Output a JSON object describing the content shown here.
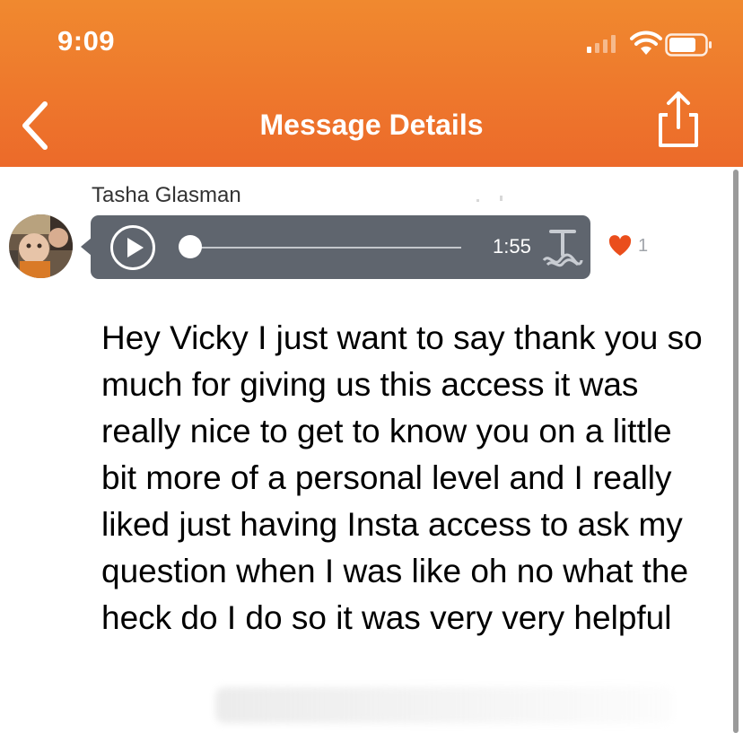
{
  "status_bar": {
    "time": "9:09",
    "signal_icon": "cellular-signal-icon",
    "wifi_icon": "wifi-icon",
    "battery_icon": "battery-icon"
  },
  "header": {
    "title": "Message Details",
    "back_icon": "chevron-left-icon",
    "share_icon": "share-icon",
    "background_color": "#ec6a2a"
  },
  "message": {
    "sender_name": "Tasha Glasman",
    "audio": {
      "duration": "1:55",
      "progress": 0,
      "play_icon": "play-icon",
      "transcribe_icon": "transcribe-icon"
    },
    "likes": {
      "icon": "heart-icon",
      "count": "1",
      "color": "#ea4e1c"
    },
    "transcript": "Hey Vicky I just want to say thank you so much for giving us this access it was really nice to get to know you on a little bit more of a personal level and I really liked just having Insta access to ask my question when I was like oh no what the heck do I do so it was very very helpful"
  }
}
